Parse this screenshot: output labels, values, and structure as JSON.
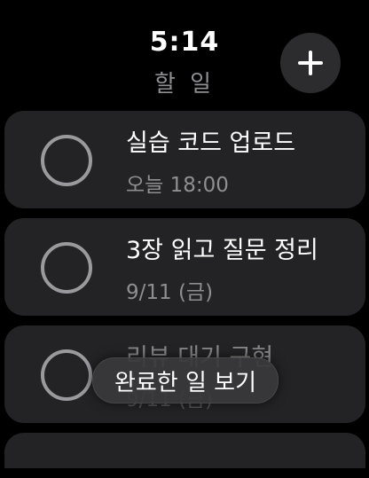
{
  "status": {
    "time": "5:14"
  },
  "header": {
    "title": "할 일",
    "add_icon": "plus-icon"
  },
  "tasks": [
    {
      "title": "실습 코드 업로드",
      "subtitle": "오늘 18:00",
      "completed": false
    },
    {
      "title": "3장 읽고 질문 정리",
      "subtitle": "9/11 (금)",
      "completed": false
    },
    {
      "title": "리뷰 대기 구현",
      "subtitle": "9/11 (금)",
      "completed": false
    }
  ],
  "footer": {
    "show_completed_label": "완료한 일 보기"
  },
  "colors": {
    "background": "#000000",
    "card": "#232325",
    "secondary_text": "#8e8e93",
    "circle": "#9a9a9e"
  }
}
